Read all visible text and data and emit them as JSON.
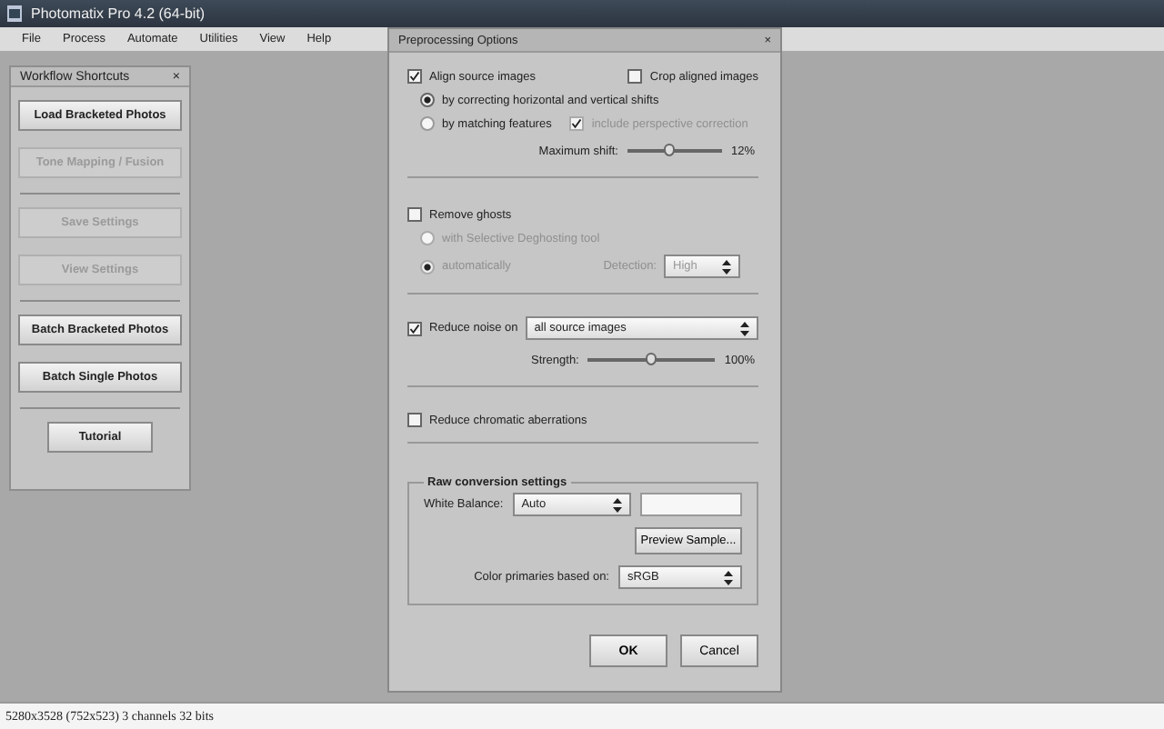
{
  "window": {
    "title": "Photomatix Pro 4.2 (64-bit)"
  },
  "menu": [
    "File",
    "Process",
    "Automate",
    "Utilities",
    "View",
    "Help"
  ],
  "workflow_panel": {
    "title": "Workflow Shortcuts",
    "close": "×",
    "groups": [
      [
        {
          "label": "Load Bracketed Photos",
          "disabled": false,
          "kind": "wide"
        },
        {
          "label": "Tone Mapping / Fusion",
          "disabled": true,
          "kind": "wide"
        }
      ],
      [
        {
          "label": "Save Settings",
          "disabled": true,
          "kind": "wide"
        },
        {
          "label": "View Settings",
          "disabled": true,
          "kind": "wide"
        }
      ],
      [
        {
          "label": "Batch Bracketed Photos",
          "disabled": false,
          "kind": "wide"
        },
        {
          "label": "Batch Single Photos",
          "disabled": false,
          "kind": "wide"
        }
      ],
      [
        {
          "label": "Tutorial",
          "disabled": false,
          "kind": "small"
        }
      ]
    ]
  },
  "dialog": {
    "title": "Preprocessing Options",
    "close": "×",
    "align": {
      "label": "Align source images",
      "checked": true,
      "crop": {
        "label": "Crop aligned images",
        "checked": false
      },
      "options": [
        {
          "label": "by correcting horizontal and vertical shifts",
          "selected": true
        },
        {
          "label": "by matching features",
          "selected": false
        }
      ],
      "perspective": {
        "label": "include perspective correction",
        "checked": true,
        "disabled": true
      },
      "max_shift": {
        "label": "Maximum shift:",
        "level": 0.45,
        "reading": "12%"
      }
    },
    "ghosts": {
      "label": "Remove ghosts",
      "checked": false,
      "options": [
        {
          "label": "with Selective Deghosting tool",
          "selected": false,
          "disabled": true
        },
        {
          "label": "automatically",
          "selected": true,
          "disabled": true
        }
      ],
      "detection": {
        "label": "Detection:",
        "value": "High",
        "disabled": true
      }
    },
    "noise": {
      "label": "Reduce noise on",
      "checked": true,
      "value": "all source images",
      "strength": {
        "label": "Strength:",
        "level": 0.5,
        "reading": "100%"
      }
    },
    "chromatic": {
      "label": "Reduce chromatic aberrations",
      "checked": false
    },
    "raw": {
      "title": "Raw conversion settings",
      "white_balance": {
        "label": "White Balance:",
        "value": "Auto"
      },
      "preview_button": "Preview Sample...",
      "primaries": {
        "label": "Color primaries based on:",
        "value": "sRGB"
      }
    },
    "buttons": [
      "OK",
      "Cancel"
    ]
  },
  "status_bar": "5280x3528 (752x523) 3 channels 32 bits"
}
